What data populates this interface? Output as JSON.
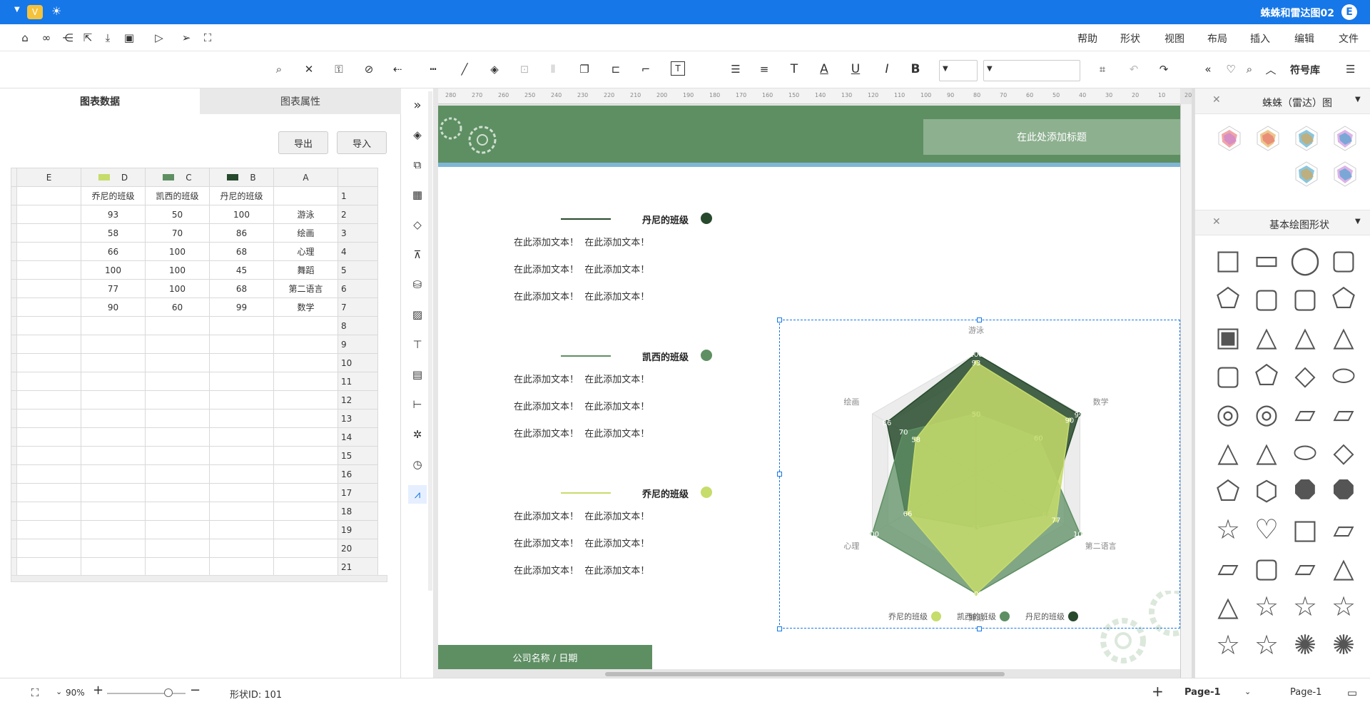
{
  "title_bar": {
    "doc_name": "蛛蛛和雷达图02"
  },
  "menu": [
    "文件",
    "编辑",
    "插入",
    "布局",
    "视图",
    "形状",
    "帮助"
  ],
  "toolbar": {
    "font_size_value": "",
    "font_name_value": ""
  },
  "symbol_library": {
    "title": "符号库",
    "section1": "蛛蛛（雷达）图",
    "section2": "基本绘图形状"
  },
  "left_panel": {
    "tab_data": "图表数据",
    "tab_props": "图表属性",
    "import_label": "导入",
    "export_label": "导出",
    "col_letters": [
      "A",
      "B",
      "C",
      "D",
      "E"
    ],
    "col_colors": [
      "#274a2c",
      "#5e8f63",
      "#c6dc6b"
    ],
    "header_row": [
      "",
      "丹尼的班级",
      "凯西的班级",
      "乔尼的班级",
      ""
    ],
    "rows": [
      [
        "游泳",
        "100",
        "50",
        "93",
        ""
      ],
      [
        "绘画",
        "86",
        "70",
        "58",
        ""
      ],
      [
        "心理",
        "68",
        "100",
        "66",
        ""
      ],
      [
        "舞蹈",
        "45",
        "100",
        "100",
        ""
      ],
      [
        "第二语言",
        "68",
        "100",
        "77",
        ""
      ],
      [
        "数学",
        "99",
        "60",
        "90",
        ""
      ]
    ],
    "row_numbers": [
      "1",
      "2",
      "3",
      "4",
      "5",
      "6",
      "7",
      "8",
      "9",
      "10",
      "11",
      "12",
      "13",
      "14",
      "15",
      "16",
      "17",
      "18",
      "19",
      "20",
      "21"
    ]
  },
  "canvas": {
    "banner_title": "在此处添加标题",
    "footer_label": "公司名称 / 日期",
    "sections": [
      {
        "name": "丹尼的班级",
        "color": "#274a2c",
        "lines": [
          "在此添加文本！  在此添加文本！",
          "在此添加文本！  在此添加文本！",
          "在此添加文本！  在此添加文本！"
        ]
      },
      {
        "name": "凯西的班级",
        "color": "#5e8f63",
        "lines": [
          "在此添加文本！  在此添加文本！",
          "在此添加文本！  在此添加文本！",
          "在此添加文本！  在此添加文本！"
        ]
      },
      {
        "name": "乔尼的班级",
        "color": "#c6dc6b",
        "lines": [
          "在此添加文本！  在此添加文本！",
          "在此添加文本！  在此添加文本！",
          "在此添加文本！  在此添加文本！"
        ]
      }
    ]
  },
  "chart_data": {
    "type": "radar",
    "categories": [
      "游泳",
      "绘画",
      "心理",
      "舞蹈",
      "第二语言",
      "数学"
    ],
    "series": [
      {
        "name": "丹尼的班级",
        "color": "#274a2c",
        "values": [
          100,
          86,
          68,
          45,
          68,
          99
        ]
      },
      {
        "name": "凯西的班级",
        "color": "#5e8f63",
        "values": [
          50,
          70,
          100,
          100,
          100,
          60
        ]
      },
      {
        "name": "乔尼的班级",
        "color": "#c6dc6b",
        "values": [
          93,
          58,
          66,
          100,
          77,
          90
        ]
      }
    ],
    "range": [
      0,
      100
    ],
    "legend_position": "bottom"
  },
  "status_bar": {
    "page_name": "Page-1",
    "page_tab": "Page-1",
    "shape_id": "形状ID: 101",
    "zoom": "90%"
  },
  "ruler_labels": [
    "280",
    "270",
    "260",
    "250",
    "240",
    "230",
    "220",
    "210",
    "200",
    "190",
    "180",
    "170",
    "160",
    "150",
    "140",
    "130",
    "120",
    "110",
    "100",
    "90",
    "80",
    "70",
    "60",
    "50",
    "40",
    "30",
    "20",
    "10",
    "20"
  ]
}
